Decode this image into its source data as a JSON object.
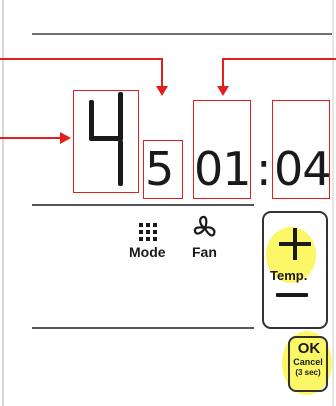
{
  "display": {
    "big_digit": "4",
    "minute_digit": "5",
    "clock_hours": "01",
    "clock_separator": ":",
    "clock_minutes": "04"
  },
  "controls": {
    "mode_label": "Mode",
    "fan_label": "Fan",
    "temp_label": "Temp.",
    "ok_label": "OK",
    "cancel_label": "Cancel",
    "cancel_hint": "(3 sec)"
  },
  "icons": {
    "mode": "grid-icon",
    "fan": "fan-icon",
    "plus": "plus-icon",
    "minus": "minus-icon"
  },
  "colors": {
    "annotation": "#e21f1f",
    "highlight": "#faf546",
    "ink": "#1a1a1a"
  }
}
